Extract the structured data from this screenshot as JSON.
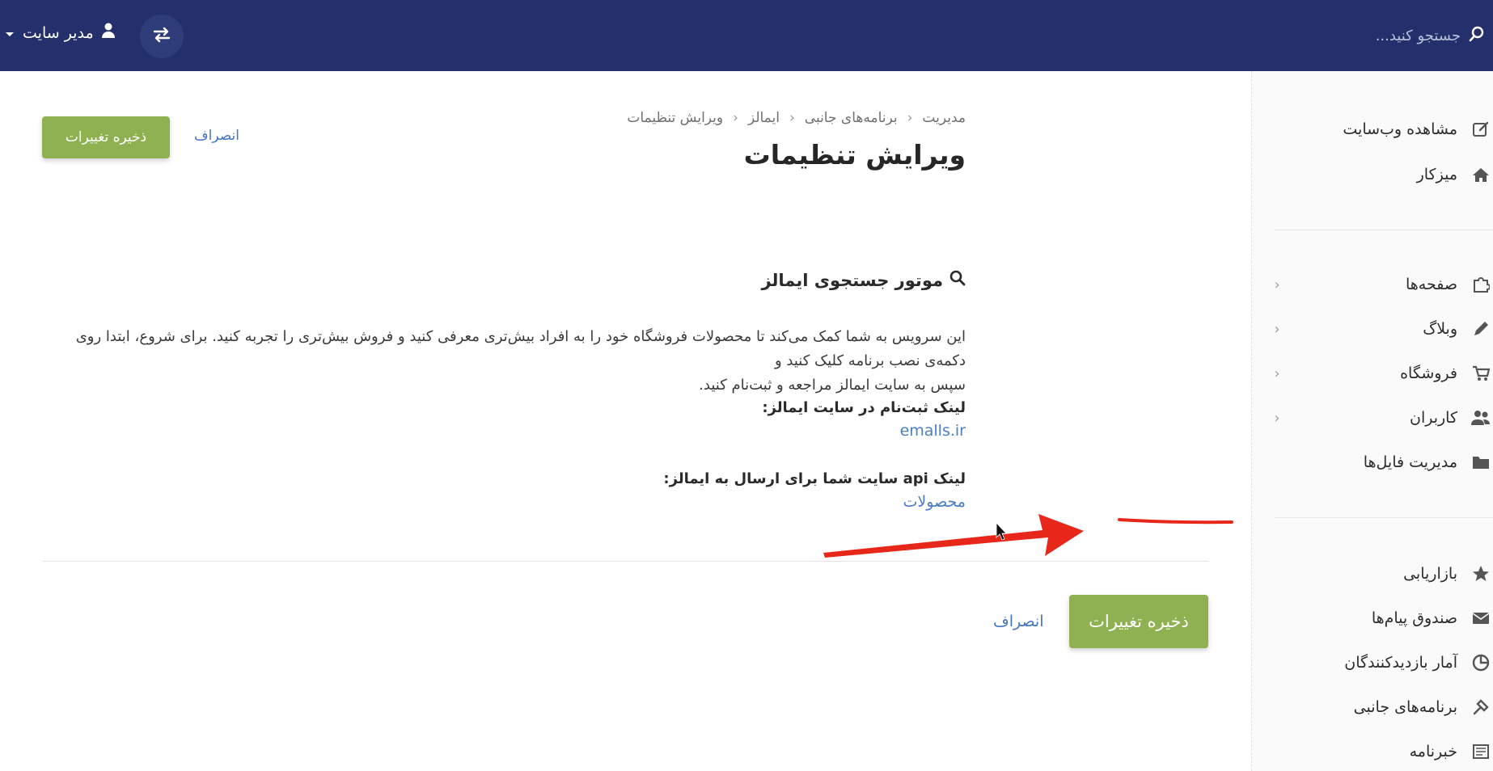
{
  "topbar": {
    "search_placeholder": "جستجو کنید...",
    "user_label": "مدیر سایت"
  },
  "sidebar": {
    "items": [
      {
        "label": "مشاهده وب‌سایت",
        "icon": "edit-icon"
      },
      {
        "label": "میزکار",
        "icon": "home-icon"
      },
      {
        "label": "صفحه‌ها",
        "icon": "puzzle-icon"
      },
      {
        "label": "وبلاگ",
        "icon": "pencil-icon"
      },
      {
        "label": "فروشگاه",
        "icon": "cart-icon"
      },
      {
        "label": "کاربران",
        "icon": "users-icon"
      },
      {
        "label": "مدیریت فایل‌ها",
        "icon": "folder-icon"
      },
      {
        "label": "بازاریابی",
        "icon": "star-icon"
      },
      {
        "label": "صندوق پیام‌ها",
        "icon": "envelope-icon"
      },
      {
        "label": "آمار بازدیدکنندگان",
        "icon": "pie-chart-icon"
      },
      {
        "label": "برنامه‌های جانبی",
        "icon": "plugin-icon"
      },
      {
        "label": "خبرنامه",
        "icon": "newspaper-icon"
      }
    ]
  },
  "breadcrumb": [
    "مدیریت",
    "برنامه‌های جانبی",
    "ایمالز",
    "ویرایش تنظیمات"
  ],
  "page_title": "ویرایش تنظیمات",
  "actions": {
    "save_label": "ذخیره تغییرات",
    "cancel_label": "انصراف"
  },
  "section": {
    "title": "موتور جستجوی ایمالز",
    "description_line1": "این سرویس به شما کمک می‌کند تا محصولات فروشگاه خود را به افراد بیش‌تری معرفی کنید و فروش بیش‌تری را تجربه کنید. برای شروع، ابتدا روی دکمه‌ی نصب برنامه کلیک کنید و",
    "description_line2": "سپس به سایت ایمالز مراجعه و ثبت‌نام کنید.",
    "register_label": "لینک ثبت‌نام در سایت ایمالز:",
    "register_link": "emalls.ir",
    "api_label": "لینک api سایت شما برای ارسال به ایمالز:",
    "api_link": "محصولات"
  },
  "colors": {
    "topbar": "#24306b",
    "save_button": "#8fb152",
    "link": "#4a7ec7",
    "annotation": "#e8271b"
  }
}
